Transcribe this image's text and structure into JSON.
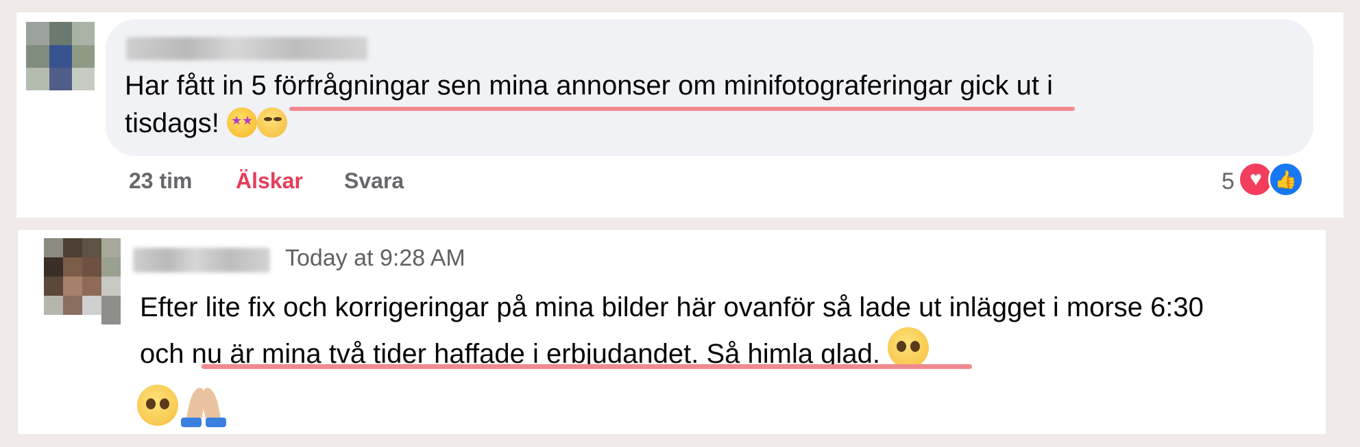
{
  "comment1": {
    "author_blurred": true,
    "text_line1_before": "Har fått in ",
    "text_line1_highlight": "5 förfrågningar sen mina annonser om minifotograferingar",
    "text_line1_after": " gick ut i",
    "text_line2": "tisdags! ",
    "emojis": [
      "star-struck-emoji",
      "partying-face-emoji"
    ],
    "time": "23 tim",
    "reaction_label": "Älskar",
    "reply_label": "Svara",
    "reaction_count": "5",
    "colors": {
      "love": "#e43d5a",
      "highlight": "#f08a8f",
      "bubble": "#f0f2f5"
    }
  },
  "comment2": {
    "author_blurred": true,
    "timestamp": "Today at 9:28 AM",
    "text_line1": "Efter lite fix och korrigeringar på mina bilder här ovanför så lade ut inlägget i morse 6:30",
    "text_line2_before": "och ",
    "text_line2_highlight": "nu är mina två tider haffade i erbjudandet. Så himla glad.",
    "emojis": [
      "pleading-face-emoji",
      "pleading-face-emoji",
      "folded-hands-emoji"
    ]
  }
}
